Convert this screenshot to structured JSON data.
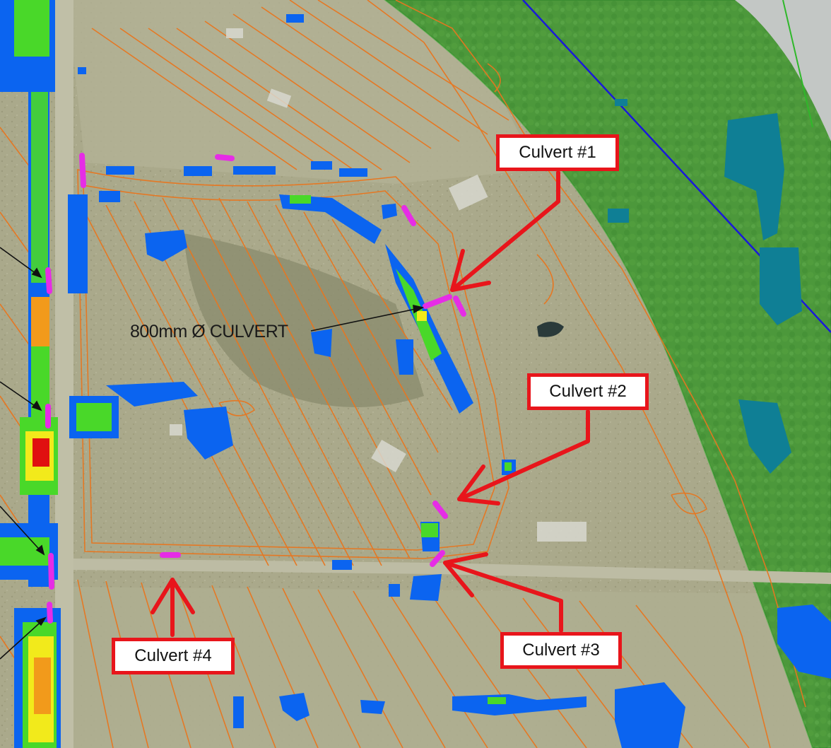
{
  "map": {
    "culverts": [
      {
        "id": 1,
        "label": "Culvert #1"
      },
      {
        "id": 2,
        "label": "Culvert #2"
      },
      {
        "id": 3,
        "label": "Culvert #3"
      },
      {
        "id": 4,
        "label": "Culvert #4"
      }
    ],
    "annotation": "800mm Ø CULVERT",
    "colors": {
      "aerial_ground": "#a9a98a",
      "contour": "#e8761f",
      "flood_shallow": "#0b64f0",
      "flood_medium": "#49d829",
      "flood_deep": "#f2ea1b",
      "flood_deeper": "#f29a1b",
      "flood_deepest": "#e01010",
      "culvert_marker": "#e62ce6",
      "callout_border": "#e8151b",
      "river_buffer": "#4ecb3d",
      "river_line": "#1a1ad8",
      "pond": "#0f7f95"
    }
  }
}
